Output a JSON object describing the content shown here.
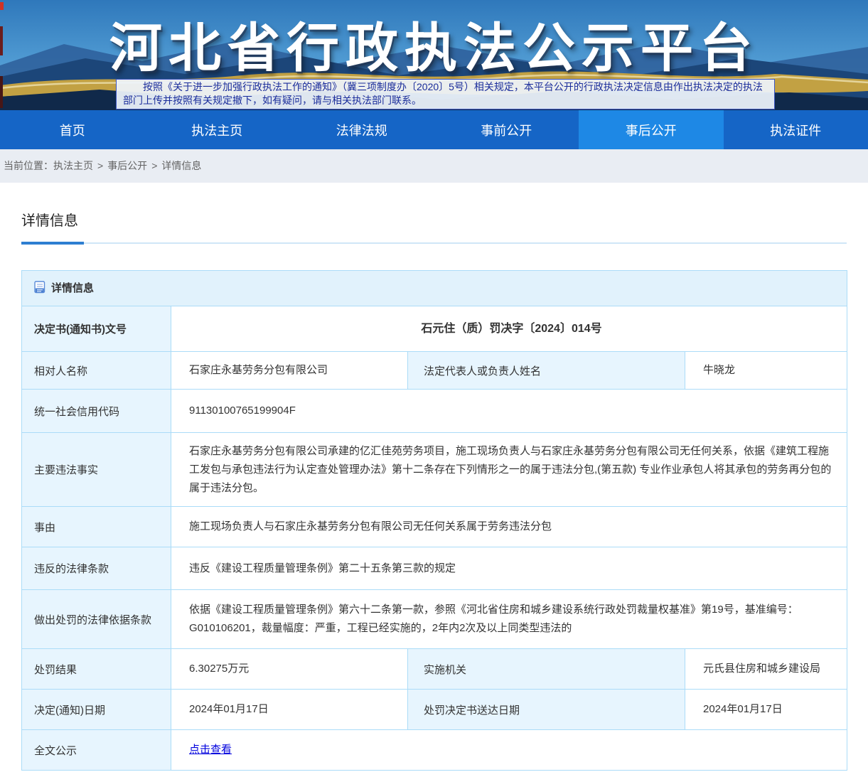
{
  "banner": {
    "title": "河北省行政执法公示平台",
    "notice": "按照《关于进一步加强行政执法工作的通知》（冀三项制度办〔2020〕5号）相关规定，本平台公开的行政执法决定信息由作出执法决定的执法部门上传并按照有关规定撤下，如有疑问，请与相关执法部门联系。"
  },
  "nav": {
    "items": [
      {
        "label": "首页",
        "active": false
      },
      {
        "label": "执法主页",
        "active": false
      },
      {
        "label": "法律法规",
        "active": false
      },
      {
        "label": "事前公开",
        "active": false
      },
      {
        "label": "事后公开",
        "active": true
      },
      {
        "label": "执法证件",
        "active": false
      }
    ]
  },
  "breadcrumb": {
    "prefix": "当前位置：",
    "items": [
      "执法主页",
      "事后公开",
      "详情信息"
    ],
    "separator": ">"
  },
  "page": {
    "title": "详情信息"
  },
  "panel": {
    "header": "详情信息",
    "icon": "document-icon"
  },
  "details": {
    "doc_no": {
      "label": "决定书(通知书)文号",
      "value": "石元住（质）罚决字〔2024〕014号"
    },
    "party": {
      "label": "相对人名称",
      "value": "石家庄永基劳务分包有限公司"
    },
    "legal_rep": {
      "label": "法定代表人或负责人姓名",
      "value": "牛晓龙"
    },
    "credit_code": {
      "label": "统一社会信用代码",
      "value": "91130100765199904F"
    },
    "facts": {
      "label": "主要违法事实",
      "value": "石家庄永基劳务分包有限公司承建的亿汇佳苑劳务项目，施工现场负责人与石家庄永基劳务分包有限公司无任何关系，依据《建筑工程施工发包与承包违法行为认定查处管理办法》第十二条存在下列情形之一的属于违法分包,(第五款) 专业作业承包人将其承包的劳务再分包的属于违法分包。"
    },
    "cause": {
      "label": "事由",
      "value": "施工现场负责人与石家庄永基劳务分包有限公司无任何关系属于劳务违法分包"
    },
    "violated_law": {
      "label": "违反的法律条款",
      "value": "违反《建设工程质量管理条例》第二十五条第三款的规定"
    },
    "penalty_basis": {
      "label": "做出处罚的法律依据条款",
      "value": "依据《建设工程质量管理条例》第六十二条第一款，参照《河北省住房和城乡建设系统行政处罚裁量权基准》第19号，基准编号：G010106201，裁量幅度：严重，工程已经实施的，2年内2次及以上同类型违法的"
    },
    "penalty_result": {
      "label": "处罚结果",
      "value": "6.30275万元"
    },
    "authority": {
      "label": "实施机关",
      "value": "元氏县住房和城乡建设局"
    },
    "decision_date": {
      "label": "决定(通知)日期",
      "value": "2024年01月17日"
    },
    "delivery_date": {
      "label": "处罚决定书送达日期",
      "value": "2024年01月17日"
    },
    "full_text": {
      "label": "全文公示",
      "link_text": "点击查看"
    }
  },
  "colors": {
    "nav_blue": "#1565c6",
    "nav_active_blue": "#1e88e5",
    "table_border": "#abdcf8",
    "label_cell_bg": "#e7f5fe",
    "section_header_bg": "#e1f2fc",
    "title_accent": "#2e7fd1",
    "link_blue": "#0101dd",
    "notice_text": "#1b2d9b"
  }
}
